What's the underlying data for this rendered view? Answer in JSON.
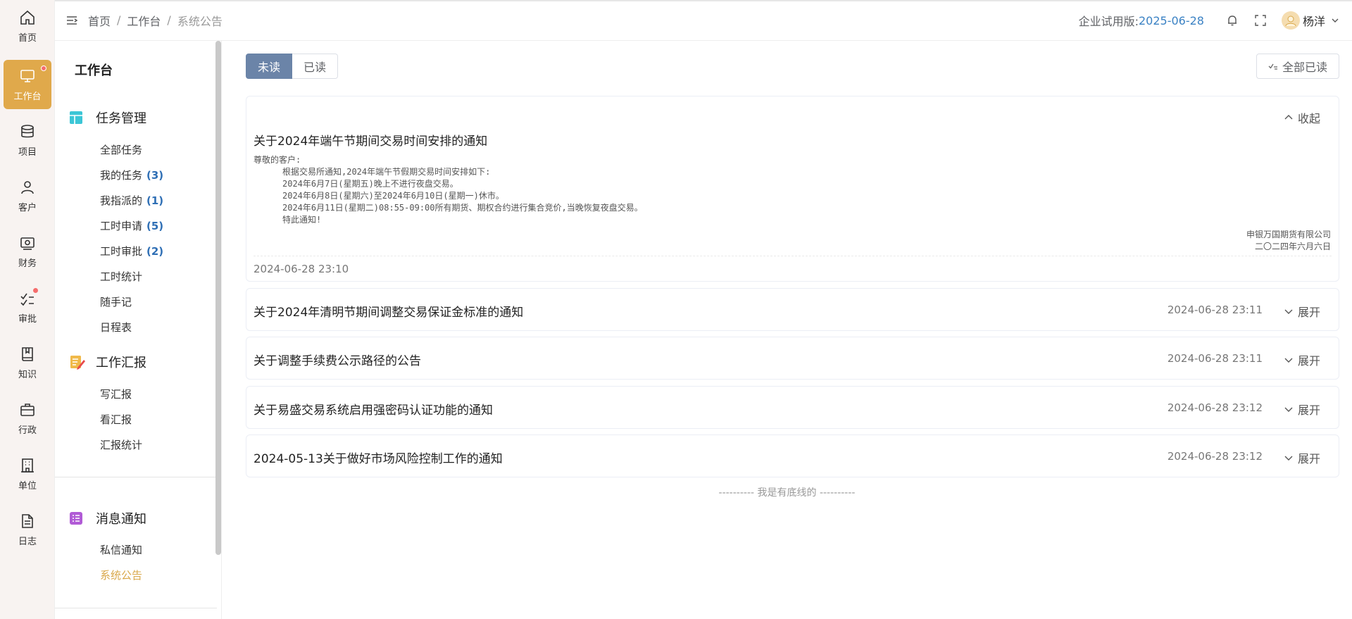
{
  "rail": [
    {
      "id": "home",
      "label": "首页",
      "icon": "home-icon"
    },
    {
      "id": "workbench",
      "label": "工作台",
      "icon": "monitor-icon",
      "active": true,
      "dot": true
    },
    {
      "id": "project",
      "label": "项目",
      "icon": "database-icon"
    },
    {
      "id": "customer",
      "label": "客户",
      "icon": "user-icon"
    },
    {
      "id": "finance",
      "label": "财务",
      "icon": "wallet-icon"
    },
    {
      "id": "approval",
      "label": "审批",
      "icon": "checklist-icon",
      "dot": true
    },
    {
      "id": "knowledge",
      "label": "知识",
      "icon": "book-icon"
    },
    {
      "id": "admin",
      "label": "行政",
      "icon": "briefcase-icon"
    },
    {
      "id": "unit",
      "label": "单位",
      "icon": "building-icon"
    },
    {
      "id": "log",
      "label": "日志",
      "icon": "document-icon"
    }
  ],
  "header": {
    "breadcrumb": [
      "首页",
      "工作台",
      "系统公告"
    ],
    "trial_label": "企业试用版:",
    "trial_date": "2025-06-28",
    "user_name": "杨洋"
  },
  "sidebar": {
    "title": "工作台",
    "groups": [
      {
        "title": "任务管理",
        "icon": "grid-icon",
        "items": [
          {
            "label": "全部任务",
            "count": ""
          },
          {
            "label": "我的任务",
            "count": "(3)"
          },
          {
            "label": "我指派的",
            "count": "(1)"
          },
          {
            "label": "工时申请",
            "count": "(5)"
          },
          {
            "label": "工时审批",
            "count": "(2)"
          },
          {
            "label": "工时统计",
            "count": ""
          },
          {
            "label": "随手记",
            "count": ""
          },
          {
            "label": "日程表",
            "count": ""
          }
        ]
      },
      {
        "title": "工作汇报",
        "icon": "report-icon",
        "items": [
          {
            "label": "写汇报",
            "count": ""
          },
          {
            "label": "看汇报",
            "count": ""
          },
          {
            "label": "汇报统计",
            "count": ""
          }
        ]
      },
      {
        "title": "消息通知",
        "icon": "message-list-icon",
        "items": [
          {
            "label": "私信通知",
            "count": ""
          },
          {
            "label": "系统公告",
            "count": "",
            "active": true
          }
        ]
      }
    ]
  },
  "main": {
    "tabs": [
      {
        "label": "未读",
        "active": true
      },
      {
        "label": "已读",
        "active": false
      }
    ],
    "mark_all_label": "全部已读",
    "expanded_notice": {
      "title": "关于2024年端午节期间交易时间安排的通知",
      "toggle_label": "收起",
      "body": {
        "greeting": "尊敬的客户:",
        "lines": [
          "根据交易所通知,2024年端午节假期交易时间安排如下:",
          "2024年6月7日(星期五)晚上不进行夜盘交易。",
          "2024年6月8日(星期六)至2024年6月10日(星期一)休市。",
          "2024年6月11日(星期二)08:55-09:00所有期货、期权合约进行集合竞价,当晚恢复夜盘交易。",
          "特此通知!"
        ],
        "signature": "申银万国期货有限公司",
        "sign_date": "二〇二四年六月六日"
      },
      "time": "2024-06-28 23:10"
    },
    "notices": [
      {
        "title": "关于2024年清明节期间调整交易保证金标准的通知",
        "time": "2024-06-28 23:11",
        "toggle_label": "展开"
      },
      {
        "title": "关于调整手续费公示路径的公告",
        "time": "2024-06-28 23:11",
        "toggle_label": "展开"
      },
      {
        "title": "关于易盛交易系统启用强密码认证功能的通知",
        "time": "2024-06-28 23:12",
        "toggle_label": "展开"
      },
      {
        "title": "2024-05-13关于做好市场风险控制工作的通知",
        "time": "2024-06-28 23:12",
        "toggle_label": "展开"
      }
    ],
    "end_text": "---------- 我是有底线的 ----------"
  },
  "colors": {
    "accent": "#e0a94b",
    "tab_active": "#6b84a8",
    "count_blue": "#2f6fb5",
    "date_blue": "#3b82c4",
    "dot_red": "#f56c6c"
  }
}
